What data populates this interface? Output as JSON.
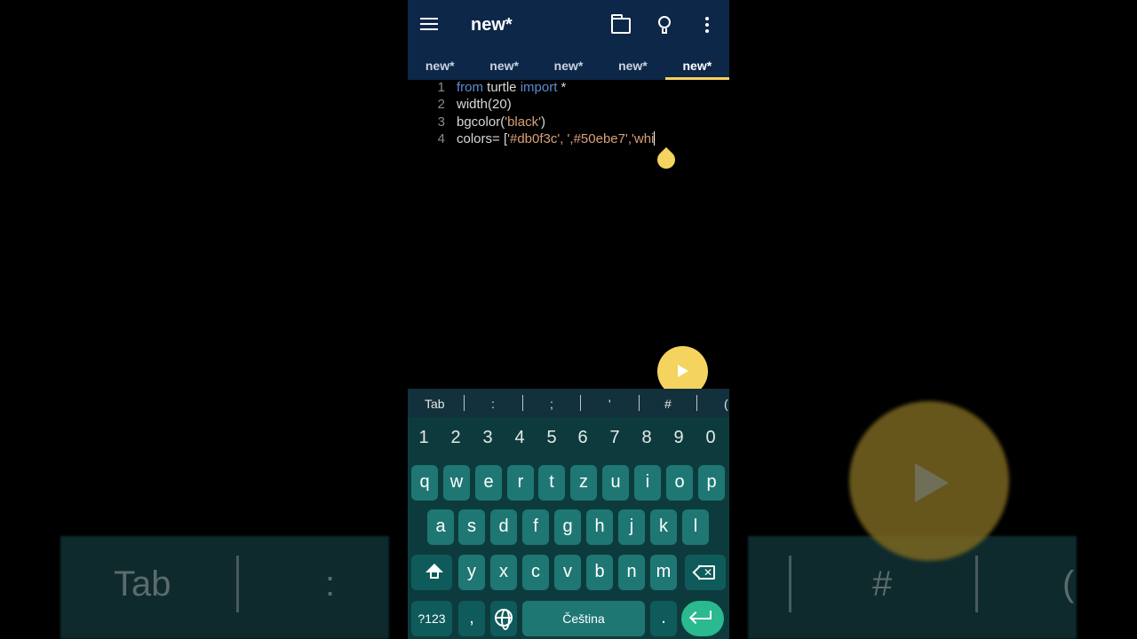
{
  "app": {
    "title": "new*"
  },
  "tabs": [
    "new*",
    "new*",
    "new*",
    "new*",
    "new*"
  ],
  "editor": {
    "lines": [
      {
        "num": "1",
        "parts": [
          {
            "t": "from",
            "c": "kw"
          },
          {
            "t": " turtle ",
            "c": ""
          },
          {
            "t": "import",
            "c": "kw"
          },
          {
            "t": " *",
            "c": ""
          }
        ]
      },
      {
        "num": "2",
        "parts": [
          {
            "t": "width(20)",
            "c": ""
          }
        ]
      },
      {
        "num": "3",
        "parts": [
          {
            "t": "bgcolor(",
            "c": ""
          },
          {
            "t": "'black'",
            "c": "str"
          },
          {
            "t": ")",
            "c": ""
          }
        ]
      },
      {
        "num": "4",
        "parts": [
          {
            "t": "colors= [",
            "c": ""
          },
          {
            "t": "'#db0f3c', ',#50ebe7','whi",
            "c": "str"
          }
        ]
      }
    ]
  },
  "symbols": [
    "Tab",
    ":",
    ";",
    "'",
    "#",
    "("
  ],
  "keyboard": {
    "numbers": [
      "1",
      "2",
      "3",
      "4",
      "5",
      "6",
      "7",
      "8",
      "9",
      "0"
    ],
    "row1": [
      "q",
      "w",
      "e",
      "r",
      "t",
      "z",
      "u",
      "i",
      "o",
      "p"
    ],
    "row2": [
      "a",
      "s",
      "d",
      "f",
      "g",
      "h",
      "j",
      "k",
      "l"
    ],
    "row3": [
      "y",
      "x",
      "c",
      "v",
      "b",
      "n",
      "m"
    ],
    "sym_key": "?123",
    "comma": ",",
    "space_label": "Čeština",
    "period": "."
  },
  "background": {
    "tab": "Tab",
    "colon": ":",
    "hash": "#",
    "paren": "("
  },
  "colors": {
    "appbar": "#0d2748",
    "accent": "#f4d35e",
    "keyboard": "#0d3b3d",
    "key": "#1f7774",
    "enter": "#2bb98f"
  }
}
